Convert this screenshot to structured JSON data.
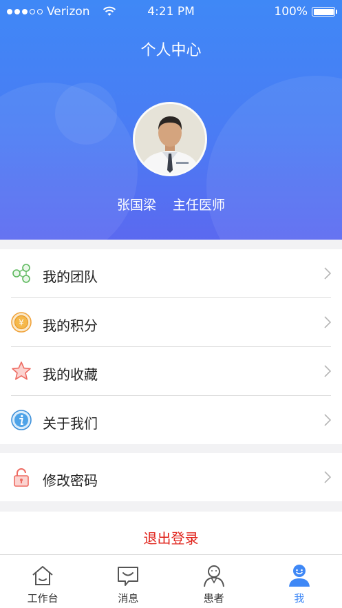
{
  "status_bar": {
    "carrier": "Verizon",
    "time": "4:21 PM",
    "battery": "100%",
    "signal_filled": 3,
    "signal_total": 5
  },
  "header": {
    "title": "个人中心",
    "doctor_name": "张国梁",
    "doctor_title": "主任医师"
  },
  "menu": {
    "group1": [
      {
        "label": "我的团队",
        "icon": "team-icon"
      },
      {
        "label": "我的积分",
        "icon": "points-coin-icon"
      },
      {
        "label": "我的收藏",
        "icon": "star-icon"
      },
      {
        "label": "关于我们",
        "icon": "info-icon"
      }
    ],
    "group2": [
      {
        "label": "修改密码",
        "icon": "lock-icon"
      }
    ]
  },
  "logout": {
    "label": "退出登录"
  },
  "tabbar": [
    {
      "label": "工作台",
      "icon": "home-icon",
      "active": false
    },
    {
      "label": "消息",
      "icon": "message-icon",
      "active": false
    },
    {
      "label": "患者",
      "icon": "patient-icon",
      "active": false
    },
    {
      "label": "我",
      "icon": "profile-icon",
      "active": true
    }
  ],
  "colors": {
    "header_gradient_top": "#3f88f6",
    "header_gradient_bottom": "#5b69f0",
    "accent": "#3f88f6",
    "logout_red": "#e0231b"
  }
}
